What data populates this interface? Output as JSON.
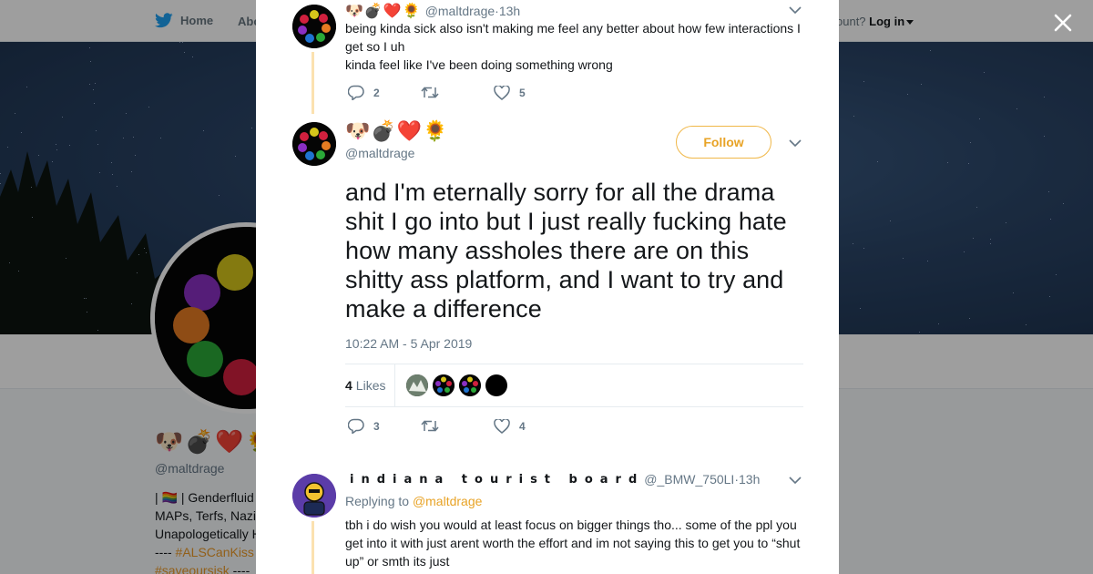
{
  "nav": {
    "home_label": "Home",
    "about_label": "Abo",
    "account_prefix": "ccount?",
    "login_label": "Log in"
  },
  "profile": {
    "name_emoji": "🐶💣❤️🌻",
    "handle": "@maltdrage",
    "bio_lines": [
      "| 🏳️‍🌈 | Genderfluid",
      "MAPs, Terfs, Nazi",
      "Unapologetically H"
    ],
    "bio_tags_line": {
      "prefix": "---- ",
      "tag": "#ALSCanKiss"
    },
    "bio_tags_line2": {
      "tag": "#saveoursisk",
      "suffix": " ----"
    }
  },
  "modal": {
    "close_label": "✕",
    "accent_color": "#e8a326"
  },
  "prev_tweet": {
    "name_emoji": "🐶💣❤️🌻",
    "handle": "@maltdrage",
    "separator": " · ",
    "time": "13h",
    "text_line1": "being kinda sick also isn't making me feel any better about how few interactions I get so I uh",
    "text_line2": "kinda feel like I've been doing something wrong",
    "replies": "2",
    "retweets": "",
    "likes": "5"
  },
  "main_tweet": {
    "name_emoji": "🐶💣❤️🌻",
    "handle": "@maltdrage",
    "follow_label": "Follow",
    "text": "and I'm eternally sorry for all the drama shit I go into but I just really fucking hate how many assholes there are on this shitty ass platform, and I want to try and make a difference",
    "timestamp": "10:22 AM - 5 Apr 2019",
    "likes_count": "4",
    "likes_label": "Likes",
    "replies": "3",
    "retweets": "",
    "likes": "4"
  },
  "reply_tweet": {
    "name": "indiana tourist board",
    "handle": "@_BMW_750LI",
    "separator": " · ",
    "time": "13h",
    "replying_prefix": "Replying to ",
    "replying_to": "@maltdrage",
    "text": "tbh i do wish you would at least focus on bigger things tho... some of the ppl you get into it with just arent worth the effort and im not saying this to get you to “shut up” or smth its just"
  },
  "icons": {
    "twitter": "twitter-bird-icon",
    "reply": "reply-icon",
    "retweet": "retweet-icon",
    "like": "heart-icon",
    "chevron": "chevron-down-icon",
    "close": "close-icon"
  }
}
